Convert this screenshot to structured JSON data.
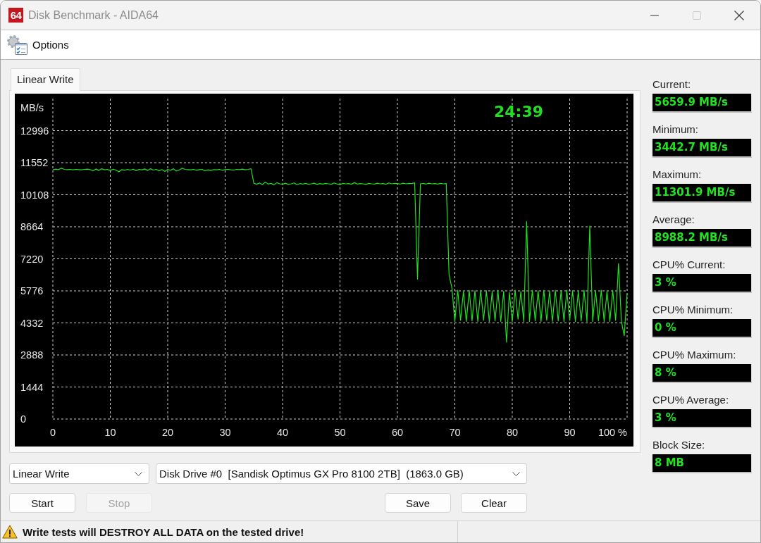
{
  "window": {
    "logo_text": "64",
    "title": "Disk Benchmark - AIDA64",
    "controls": [
      {
        "kind": "minimize",
        "disabled": false
      },
      {
        "kind": "maximize",
        "disabled": true
      },
      {
        "kind": "close",
        "disabled": false
      }
    ]
  },
  "toolbar": {
    "items": [
      {
        "label": "Options"
      }
    ]
  },
  "tabs": [
    {
      "label": "Linear Write",
      "selected": true
    }
  ],
  "chart_panel": {
    "timer": "24:39",
    "chart_data": {
      "type": "line",
      "ylabel": "MB/s",
      "grid": true,
      "xlim": [
        0,
        100
      ],
      "ylim": [
        0,
        14440
      ],
      "xticks": [
        0,
        10,
        20,
        30,
        40,
        50,
        60,
        70,
        80,
        90,
        {
          "value": 100,
          "label": "100 %"
        }
      ],
      "yticks": [
        0,
        1444,
        2888,
        4332,
        5776,
        7220,
        8664,
        10108,
        11552,
        12996
      ],
      "x": [
        0,
        0.5,
        1,
        1.5,
        2,
        2.5,
        3,
        3.5,
        4,
        4.5,
        5,
        5.5,
        6,
        6.5,
        7,
        7.5,
        8,
        8.5,
        9,
        9.5,
        10,
        10.5,
        11,
        11.5,
        12,
        12.5,
        13,
        13.5,
        14,
        14.5,
        15,
        15.5,
        16,
        16.5,
        17,
        17.5,
        18,
        18.5,
        19,
        19.5,
        20,
        20.5,
        21,
        21.5,
        22,
        22.5,
        23,
        23.5,
        24,
        24.5,
        25,
        25.5,
        26,
        26.5,
        27,
        27.5,
        28,
        28.5,
        29,
        29.5,
        30,
        30.5,
        31,
        31.5,
        32,
        32.5,
        33,
        33.5,
        34,
        34.5,
        35,
        35.5,
        36,
        36.5,
        37,
        37.5,
        38,
        38.5,
        39,
        39.5,
        40,
        40.5,
        41,
        41.5,
        42,
        42.5,
        43,
        43.5,
        44,
        44.5,
        45,
        45.5,
        46,
        46.5,
        47,
        47.5,
        48,
        48.5,
        49,
        49.5,
        50,
        50.5,
        51,
        51.5,
        52,
        52.5,
        53,
        53.5,
        54,
        54.5,
        55,
        55.5,
        56,
        56.5,
        57,
        57.5,
        58,
        58.5,
        59,
        59.5,
        60,
        60.5,
        61,
        61.5,
        62,
        62.5,
        63,
        63.5,
        64,
        64.5,
        65,
        65.5,
        66,
        66.5,
        67,
        67.5,
        68,
        68.5,
        69,
        69.5,
        70,
        70.5,
        71,
        71.5,
        72,
        72.5,
        73,
        73.5,
        74,
        74.5,
        75,
        75.5,
        76,
        76.5,
        77,
        77.5,
        78,
        78.5,
        79,
        79.5,
        80,
        80.5,
        81,
        81.5,
        82,
        82.5,
        83,
        83.5,
        84,
        84.5,
        85,
        85.5,
        86,
        86.5,
        87,
        87.5,
        88,
        88.5,
        89,
        89.5,
        90,
        90.5,
        91,
        91.5,
        92,
        92.5,
        93,
        93.5,
        94,
        94.5,
        95,
        95.5,
        96,
        96.5,
        97,
        97.5,
        98,
        98.5,
        99,
        99.5,
        100
      ],
      "values": [
        11230,
        11260,
        11240,
        11300,
        11250,
        11240,
        11250,
        11230,
        11250,
        11240,
        11230,
        11250,
        11260,
        11240,
        11180,
        11270,
        11200,
        11280,
        11230,
        11250,
        11200,
        11260,
        11220,
        11140,
        11240,
        11210,
        11250,
        11220,
        11260,
        11190,
        11250,
        11230,
        11270,
        11200,
        11280,
        11220,
        11250,
        11190,
        11240,
        11160,
        11250,
        11210,
        11280,
        11170,
        11220,
        11300,
        11250,
        11240,
        11230,
        11250,
        11210,
        11240,
        11250,
        11180,
        11230,
        11200,
        11240,
        11230,
        11250,
        11210,
        11240,
        11250,
        11230,
        11220,
        11250,
        11240,
        11260,
        11230,
        11250,
        11280,
        10620,
        10580,
        10640,
        10560,
        10680,
        10590,
        10620,
        10550,
        10650,
        10600,
        10580,
        10630,
        10570,
        10600,
        10640,
        10560,
        10610,
        10590,
        10620,
        10580,
        10600,
        10630,
        10570,
        10610,
        10590,
        10620,
        10600,
        10580,
        10640,
        10590,
        10560,
        10620,
        10600,
        10610,
        10580,
        10650,
        10590,
        10610,
        10600,
        10570,
        10620,
        10600,
        10590,
        10630,
        10600,
        10610,
        10580,
        10640,
        10600,
        10620,
        10610,
        10590,
        10630,
        10600,
        10620,
        10610,
        10640,
        6300,
        10600,
        10620,
        10590,
        10630,
        10600,
        10610,
        10590,
        10620,
        10600,
        10610,
        6500,
        5900,
        4400,
        5800,
        4450,
        5750,
        4400,
        5800,
        4420,
        5780,
        4400,
        5800,
        4450,
        5780,
        4400,
        5750,
        4420,
        5800,
        4400,
        5760,
        3460,
        5700,
        4400,
        5800,
        4500,
        5750,
        4400,
        8900,
        4400,
        5800,
        4420,
        5780,
        4400,
        5800,
        4450,
        5760,
        4400,
        5800,
        4420,
        5780,
        4400,
        5800,
        4450,
        5780,
        4400,
        5750,
        4420,
        5800,
        4400,
        8700,
        4400,
        5780,
        4420,
        5800,
        4400,
        5760,
        4400,
        5800,
        4450,
        7000,
        4400,
        3750,
        5660
      ]
    }
  },
  "stats": {
    "groups": [
      [
        {
          "label": "Current:",
          "value": "5659.9 MB/s"
        },
        {
          "label": "Minimum:",
          "value": "3442.7 MB/s"
        },
        {
          "label": "Maximum:",
          "value": "11301.9 MB/s"
        },
        {
          "label": "Average:",
          "value": "8988.2 MB/s"
        }
      ],
      [
        {
          "label": "CPU% Current:",
          "value": "3 %"
        },
        {
          "label": "CPU% Minimum:",
          "value": "0 %"
        },
        {
          "label": "CPU% Maximum:",
          "value": "8 %"
        },
        {
          "label": "CPU% Average:",
          "value": "3 %"
        },
        {
          "label": "Block Size:",
          "value": "8 MB"
        }
      ]
    ]
  },
  "controls": {
    "test_dropdown": {
      "value": "Linear Write"
    },
    "drive_dropdown": {
      "value": "Disk Drive #0  [Sandisk Optimus GX Pro 8100 2TB]  (1863.0 GB)"
    },
    "run_buttons": [
      {
        "label": "Start",
        "disabled": false
      },
      {
        "label": "Stop",
        "disabled": true
      }
    ],
    "result_buttons": [
      {
        "label": "Save",
        "disabled": false
      },
      {
        "label": "Clear",
        "disabled": false
      }
    ]
  },
  "status_bar": {
    "message": "Write tests will DESTROY ALL DATA on the tested drive!"
  }
}
